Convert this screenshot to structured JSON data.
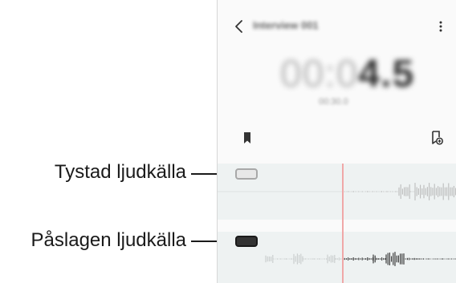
{
  "callouts": {
    "muted": "Tystad ljudkälla",
    "unmuted": "Påslagen ljudkälla"
  },
  "header": {
    "title": "Interview 001"
  },
  "timer": {
    "dim": "00:0",
    "strong": "4.5",
    "subtime": "00:30.0"
  },
  "icons": {
    "back": "chevron-left-icon",
    "more": "more-vertical-icon",
    "bookmark": "bookmark-icon",
    "add_bookmark": "add-bookmark-icon"
  },
  "tracks": [
    {
      "state": "muted"
    },
    {
      "state": "unmuted"
    }
  ],
  "colors": {
    "track_bg": "#eef2f2",
    "playhead": "#f0a8a8",
    "toggle_on": "#333333",
    "toggle_off": "#e8e8e8"
  }
}
